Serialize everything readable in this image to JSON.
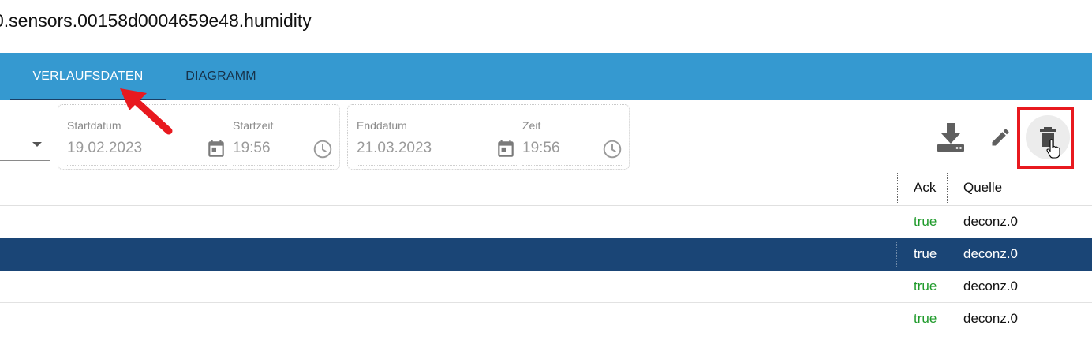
{
  "window": {
    "title": "0.sensors.00158d0004659e48.humidity"
  },
  "tabs": [
    {
      "label": "VERLAUFSDATEN",
      "active": true
    },
    {
      "label": "DIAGRAMM",
      "active": false
    }
  ],
  "filters": {
    "start_date_label": "Startdatum",
    "start_date_value": "19.02.2023",
    "start_time_label": "Startzeit",
    "start_time_value": "19:56",
    "end_date_label": "Enddatum",
    "end_date_value": "21.03.2023",
    "end_time_label": "Zeit",
    "end_time_value": "19:56"
  },
  "toolbar": {
    "icons": [
      "download-icon",
      "pencil-icon",
      "trash-icon"
    ],
    "highlight_color": "#e8191f"
  },
  "table": {
    "columns": [
      "Ack",
      "Quelle"
    ],
    "rows": [
      {
        "ack": "true",
        "source": "deconz.0",
        "selected": false
      },
      {
        "ack": "true",
        "source": "deconz.0",
        "selected": true
      },
      {
        "ack": "true",
        "source": "deconz.0",
        "selected": false
      },
      {
        "ack": "true",
        "source": "deconz.0",
        "selected": false
      }
    ]
  },
  "colors": {
    "tab_bar": "#3599d0",
    "selected_row": "#1a4576",
    "ack_true": "#1e9a2a",
    "annotation": "#e8191f"
  }
}
